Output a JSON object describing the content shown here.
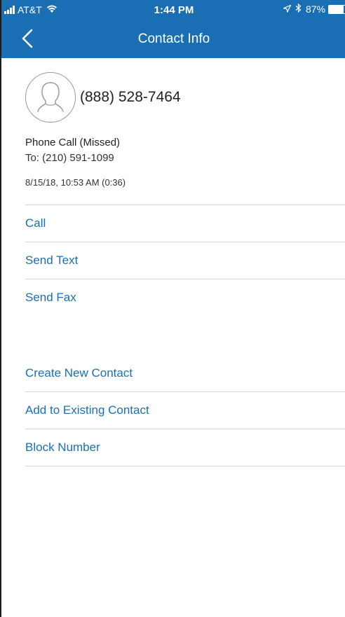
{
  "status_bar": {
    "carrier": "AT&T",
    "time": "1:44 PM",
    "battery": "87%",
    "battery_level": 0.87,
    "icons": [
      "signal-icon",
      "wifi-icon",
      "location-arrow-icon",
      "bluetooth-icon",
      "battery-icon"
    ]
  },
  "nav": {
    "title": "Contact Info",
    "back_icon": "chevron-left-icon"
  },
  "contact": {
    "avatar_icon": "person-placeholder-icon",
    "number": "(888) 528-7464"
  },
  "call": {
    "type": "Phone Call (Missed)",
    "to": "To: (210) 591-1099",
    "time": "8/15/18, 10:53 AM (0:36)"
  },
  "actions": [
    {
      "label": "Call"
    },
    {
      "label": "Send Text"
    },
    {
      "label": "Send Fax"
    }
  ],
  "contact_actions": [
    {
      "label": "Create New Contact"
    },
    {
      "label": "Add to Existing Contact"
    },
    {
      "label": "Block Number"
    }
  ],
  "colors": {
    "brand": "#1a6fb4",
    "link": "#1a6fb4",
    "divider": "#d6d6d6"
  }
}
